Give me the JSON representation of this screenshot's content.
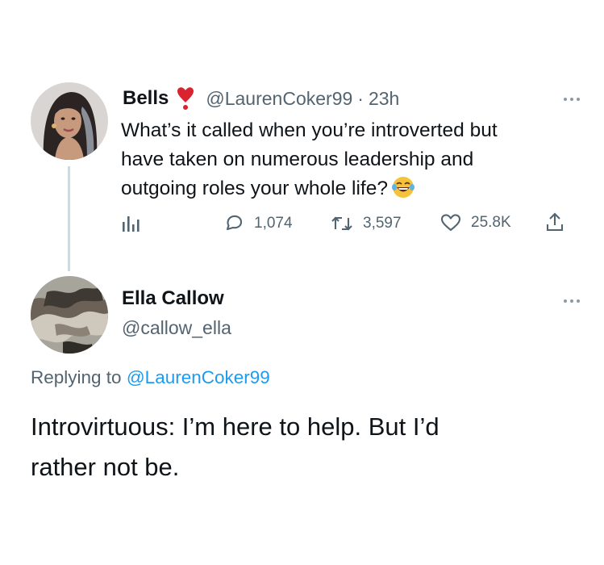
{
  "tweet": {
    "author_name": "Bells",
    "name_emoji": "heart-exclamation-icon",
    "handle": "@LaurenCoker99",
    "separator": "·",
    "time": "23h",
    "text_lines": [
      "What’s it called when you’re introverted but",
      "have taken on numerous leadership and",
      "outgoing roles your whole life?"
    ],
    "trailing_emoji": "laughing-crying-emoji-icon",
    "actions": {
      "views_icon": "analytics-icon",
      "replies": "1,074",
      "retweets": "3,597",
      "likes": "25.8K",
      "share_icon": "share-icon"
    }
  },
  "reply": {
    "author_name": "Ella Callow",
    "handle": "@callow_ella",
    "replying_prefix": "Replying to",
    "replying_to": "@LaurenCoker99",
    "text_lines": [
      "Introvirtuous: I’m here to help. But I’d",
      "rather not be."
    ]
  },
  "colors": {
    "text": "#0f1419",
    "secondary": "#536471",
    "link": "#1d9bf0",
    "thread_line": "#cfd9de"
  }
}
